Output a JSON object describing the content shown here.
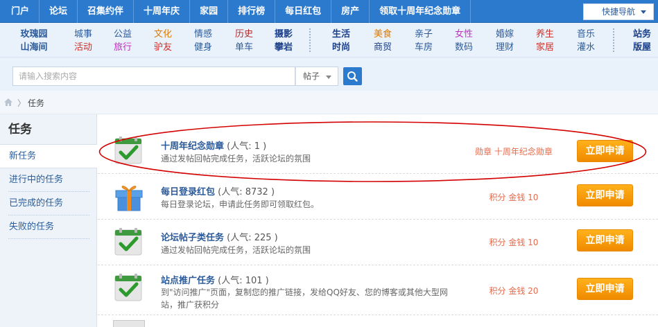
{
  "topnav": {
    "items": [
      "门户",
      "论坛",
      "召集约伴",
      "十周年庆",
      "家园",
      "排行榜",
      "每日红包",
      "房产",
      "领取十周年纪念勋章"
    ],
    "quick_nav": "快捷导航"
  },
  "categories": {
    "c1": [
      "玫瑰园",
      "山海间"
    ],
    "c2": [
      "城事",
      "活动"
    ],
    "c3": [
      "公益",
      "旅行"
    ],
    "c4": [
      "文化",
      "驴友"
    ],
    "c5": [
      "情感",
      "健身"
    ],
    "c6": [
      "历史",
      "单车"
    ],
    "c7": [
      "摄影",
      "攀岩"
    ],
    "c8": [
      "生活",
      "时尚"
    ],
    "c9": [
      "美食",
      "商贸"
    ],
    "c10": [
      "亲子",
      "车房"
    ],
    "c11": [
      "女性",
      "数码"
    ],
    "c12": [
      "婚嫁",
      "理财"
    ],
    "c13": [
      "养生",
      "家居"
    ],
    "c14": [
      "音乐",
      "灌水"
    ],
    "c15": [
      "站务",
      "版屋"
    ],
    "colors": {
      "blue": "#2b5a9a",
      "red": "#d0302a",
      "orange": "#e07a00",
      "magenta": "#c030c0",
      "navy": "#1a3f8a",
      "green": "#2a8a3a",
      "darkred": "#b02a2a"
    }
  },
  "search": {
    "placeholder": "请输入搜索内容",
    "type": "帖子"
  },
  "breadcrumb": {
    "label": "任务"
  },
  "sidebar": {
    "title": "任务",
    "items": [
      "新任务",
      "进行中的任务",
      "已完成的任务",
      "失败的任务"
    ]
  },
  "tasks": [
    {
      "name": "十周年纪念勋章",
      "popularity": "(人气: 1 )",
      "desc": "通过发帖回帖完成任务，活跃论坛的氛围",
      "reward": "勋章 十周年纪念勋章",
      "apply": "立即申请",
      "icon": "checkmark-icon"
    },
    {
      "name": "每日登录红包",
      "popularity": "(人气: 8732 )",
      "desc": "每日登录论坛，申请此任务即可领取红包。",
      "reward": "积分 金钱 10",
      "apply": "立即申请",
      "icon": "gift-icon"
    },
    {
      "name": "论坛帖子类任务",
      "popularity": "(人气: 225 )",
      "desc": "通过发帖回帖完成任务，活跃论坛的氛围",
      "reward": "积分 金钱 10",
      "apply": "立即申请",
      "icon": "checkmark-icon"
    },
    {
      "name": "站点推广任务",
      "popularity": "(人气: 101 )",
      "desc": "到\"访问推广\"页面，复制您的推广链接，发给QQ好友、您的博客或其他大型网站，推广获积分",
      "reward": "积分 金钱 20",
      "apply": "立即申请",
      "icon": "checkmark-icon"
    }
  ],
  "accent": {
    "nav_blue": "#2b7acd",
    "button_orange": "#f59a00",
    "annotation_red": "#d40000"
  }
}
